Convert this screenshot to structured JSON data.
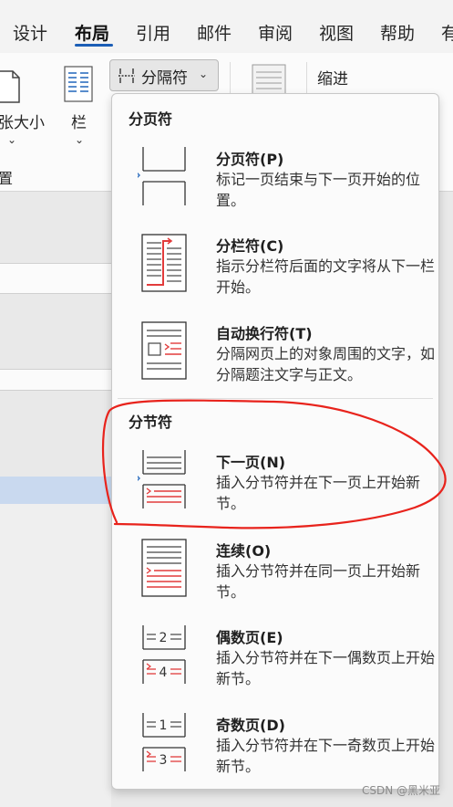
{
  "tabs": [
    "设计",
    "布局",
    "引用",
    "邮件",
    "审阅",
    "视图",
    "帮助",
    "有"
  ],
  "active_tab": "布局",
  "ribbon": {
    "size_label": "张大小",
    "columns_label": "栏",
    "group_label_left": "置",
    "breaks_button": "分隔符",
    "indent_label": "缩进"
  },
  "menu": {
    "page_breaks_header": "分页符",
    "section_breaks_header": "分节符",
    "items": [
      {
        "title": "分页符(P)",
        "desc": "标记一页结束与下一页开始的位置。"
      },
      {
        "title": "分栏符(C)",
        "desc": "指示分栏符后面的文字将从下一栏开始。"
      },
      {
        "title": "自动换行符(T)",
        "desc": "分隔网页上的对象周围的文字，如分隔题注文字与正文。"
      },
      {
        "title": "下一页(N)",
        "desc": "插入分节符并在下一页上开始新节。"
      },
      {
        "title": "连续(O)",
        "desc": "插入分节符并在同一页上开始新节。"
      },
      {
        "title": "偶数页(E)",
        "desc": "插入分节符并在下一偶数页上开始新节。"
      },
      {
        "title": "奇数页(D)",
        "desc": "插入分节符并在下一奇数页上开始新节。"
      }
    ]
  },
  "watermark": "CSDN @黑米亚",
  "colors": {
    "accent": "#1b5eb6",
    "annotation": "#e8231c",
    "thumb_red": "#e23c3c"
  }
}
